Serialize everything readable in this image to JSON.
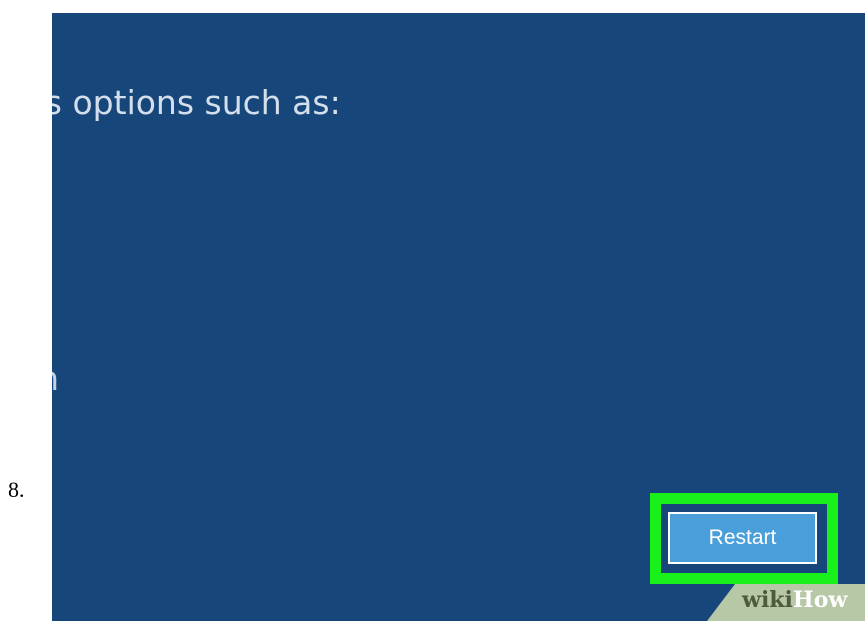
{
  "step": {
    "number": "8."
  },
  "screen": {
    "heading_clipped_char": "s",
    "heading_text": " options such as:",
    "left_fragment": "n"
  },
  "restart_button": {
    "label": "Restart"
  },
  "highlight": {
    "color": "#19f01c"
  },
  "watermark": {
    "part1": "wiki",
    "part2": "How"
  },
  "colors": {
    "screen_background": "#17467b",
    "button_background": "#4a9fdb",
    "watermark_band": "#b6c8a6"
  }
}
